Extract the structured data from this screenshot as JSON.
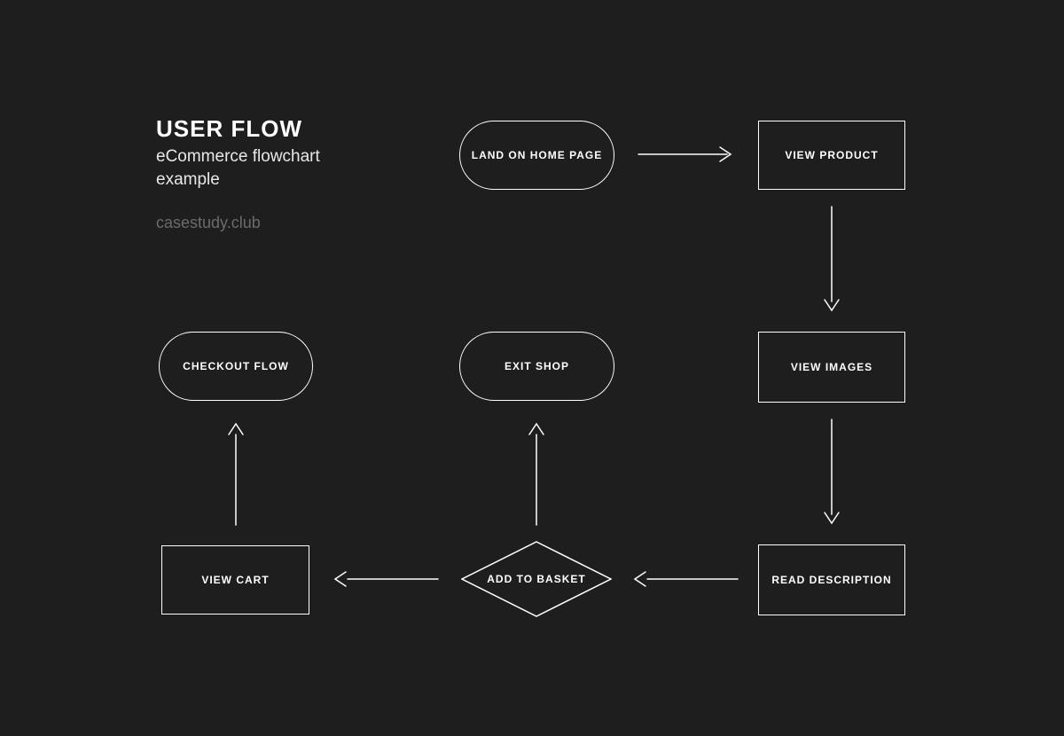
{
  "header": {
    "title": "USER FLOW",
    "subtitle": "eCommerce flowchart example",
    "credit": "casestudy.club"
  },
  "nodes": {
    "land_home": {
      "label": "LAND ON HOME PAGE",
      "shape": "pill"
    },
    "view_product": {
      "label": "VIEW PRODUCT",
      "shape": "rect"
    },
    "view_images": {
      "label": "VIEW IMAGES",
      "shape": "rect"
    },
    "read_description": {
      "label": "READ DESCRIPTION",
      "shape": "rect"
    },
    "add_to_basket": {
      "label": "ADD TO BASKET",
      "shape": "diamond"
    },
    "exit_shop": {
      "label": "EXIT SHOP",
      "shape": "pill"
    },
    "view_cart": {
      "label": "VIEW CART",
      "shape": "rect"
    },
    "checkout_flow": {
      "label": "CHECKOUT FLOW",
      "shape": "pill"
    }
  },
  "edges": [
    {
      "from": "land_home",
      "to": "view_product"
    },
    {
      "from": "view_product",
      "to": "view_images"
    },
    {
      "from": "view_images",
      "to": "read_description"
    },
    {
      "from": "read_description",
      "to": "add_to_basket"
    },
    {
      "from": "add_to_basket",
      "to": "exit_shop"
    },
    {
      "from": "add_to_basket",
      "to": "view_cart"
    },
    {
      "from": "view_cart",
      "to": "checkout_flow"
    }
  ]
}
